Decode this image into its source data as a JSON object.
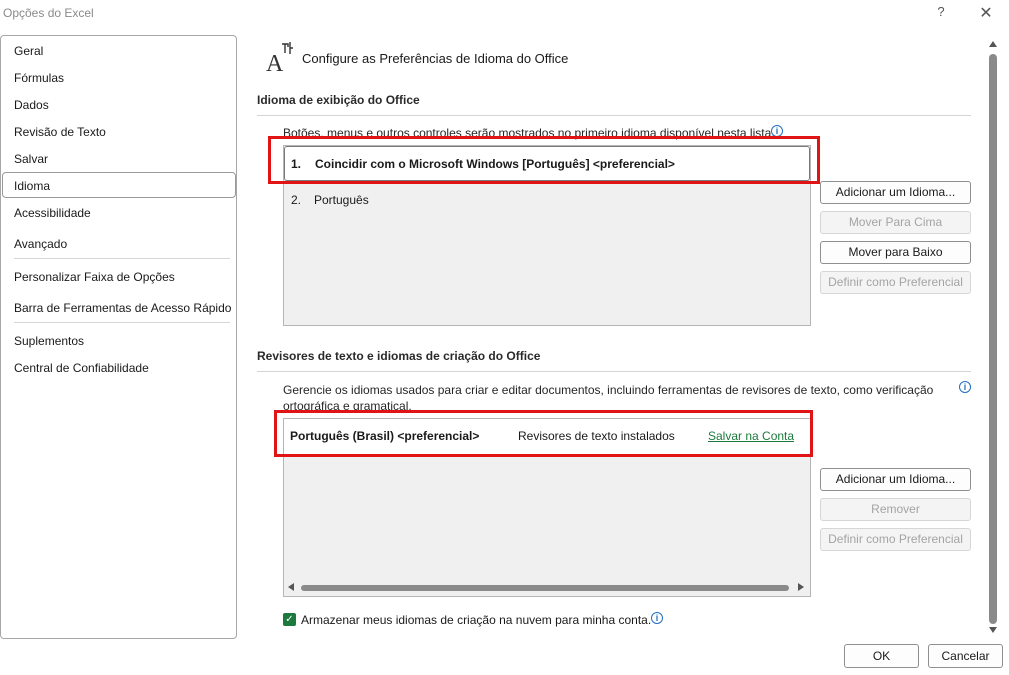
{
  "window": {
    "title": "Opções do Excel",
    "help_glyph": "?",
    "close_glyph": "✕"
  },
  "sidebar": {
    "selected": "Idioma",
    "items": [
      {
        "label": "Geral"
      },
      {
        "label": "Fórmulas"
      },
      {
        "label": "Dados"
      },
      {
        "label": "Revisão de Texto"
      },
      {
        "label": "Salvar"
      },
      {
        "label": "Idioma"
      },
      {
        "label": "Acessibilidade"
      },
      {
        "label": "Avançado"
      },
      {
        "label": "Personalizar Faixa de Opções"
      },
      {
        "label": "Barra de Ferramentas de Acesso Rápido"
      },
      {
        "label": "Suplementos"
      },
      {
        "label": "Central de Confiabilidade"
      }
    ]
  },
  "main": {
    "heading": "Configure as Preferências de Idioma do Office",
    "heading_icon": "language-icon",
    "display": {
      "title": "Idioma de exibição do Office",
      "description": "Botões, menus e outros controles serão mostrados no primeiro idioma disponível nesta lista.",
      "languages": [
        {
          "num": "1.",
          "label": "Coincidir com o Microsoft Windows [Português] <preferencial>"
        },
        {
          "num": "2.",
          "label": "Português"
        }
      ],
      "buttons": {
        "add": "Adicionar um Idioma...",
        "move_up": "Mover Para Cima",
        "move_down": "Mover para Baixo",
        "set_preferred": "Definir como Preferencial"
      }
    },
    "authoring": {
      "title": "Revisores de texto e idiomas de criação do Office",
      "description_line1": "Gerencie os idiomas usados para criar e editar documentos, incluindo ferramentas de revisores de texto, como verificação",
      "description_line2": "ortográfica e gramatical.",
      "row": {
        "language": "Português (Brasil) <preferencial>",
        "status": "Revisores de texto instalados",
        "action": "Salvar na Conta"
      },
      "buttons": {
        "add": "Adicionar um Idioma...",
        "remove": "Remover",
        "set_preferred": "Definir como Preferencial"
      },
      "checkbox_label": "Armazenar meus idiomas de criação na nuvem para minha conta.",
      "checkbox_checked": true
    }
  },
  "footer": {
    "ok": "OK",
    "cancel": "Cancelar"
  },
  "colors": {
    "highlight_box": "#e01414",
    "link": "#1e7a3c",
    "info": "#1f6fc5"
  }
}
